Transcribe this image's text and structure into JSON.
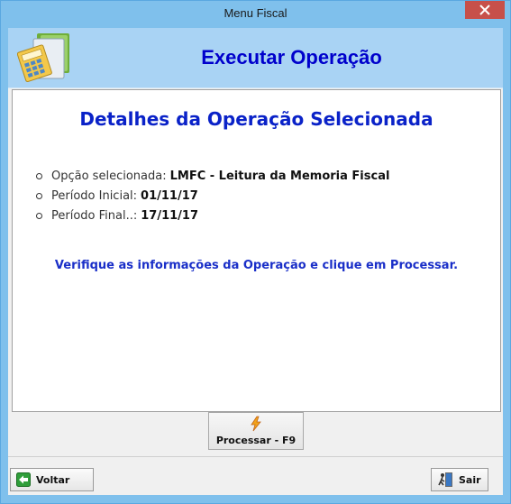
{
  "window": {
    "title": "Menu Fiscal"
  },
  "header": {
    "title": "Executar Operação"
  },
  "panel": {
    "title": "Detalhes da Operação Selecionada",
    "items": [
      {
        "label": "Opção selecionada:",
        "value": "LMFC - Leitura da Memoria Fiscal"
      },
      {
        "label": "Período Inicial:",
        "value": "01/11/17"
      },
      {
        "label": "Período Final..:",
        "value": "17/11/17"
      }
    ],
    "hint": "Verifique as informações da Operação e clique em Processar."
  },
  "buttons": {
    "process": "Processar - F9",
    "back": "Voltar",
    "exit": "Sair"
  },
  "colors": {
    "title_blue": "#0000cc",
    "header_bg": "#a9d3f4",
    "frame": "#7fc0ec",
    "close": "#c7504a"
  },
  "icons": {
    "logo": "calculator-folder-icon",
    "process": "lightning-icon",
    "back": "arrow-left-icon",
    "exit": "exit-door-icon"
  }
}
